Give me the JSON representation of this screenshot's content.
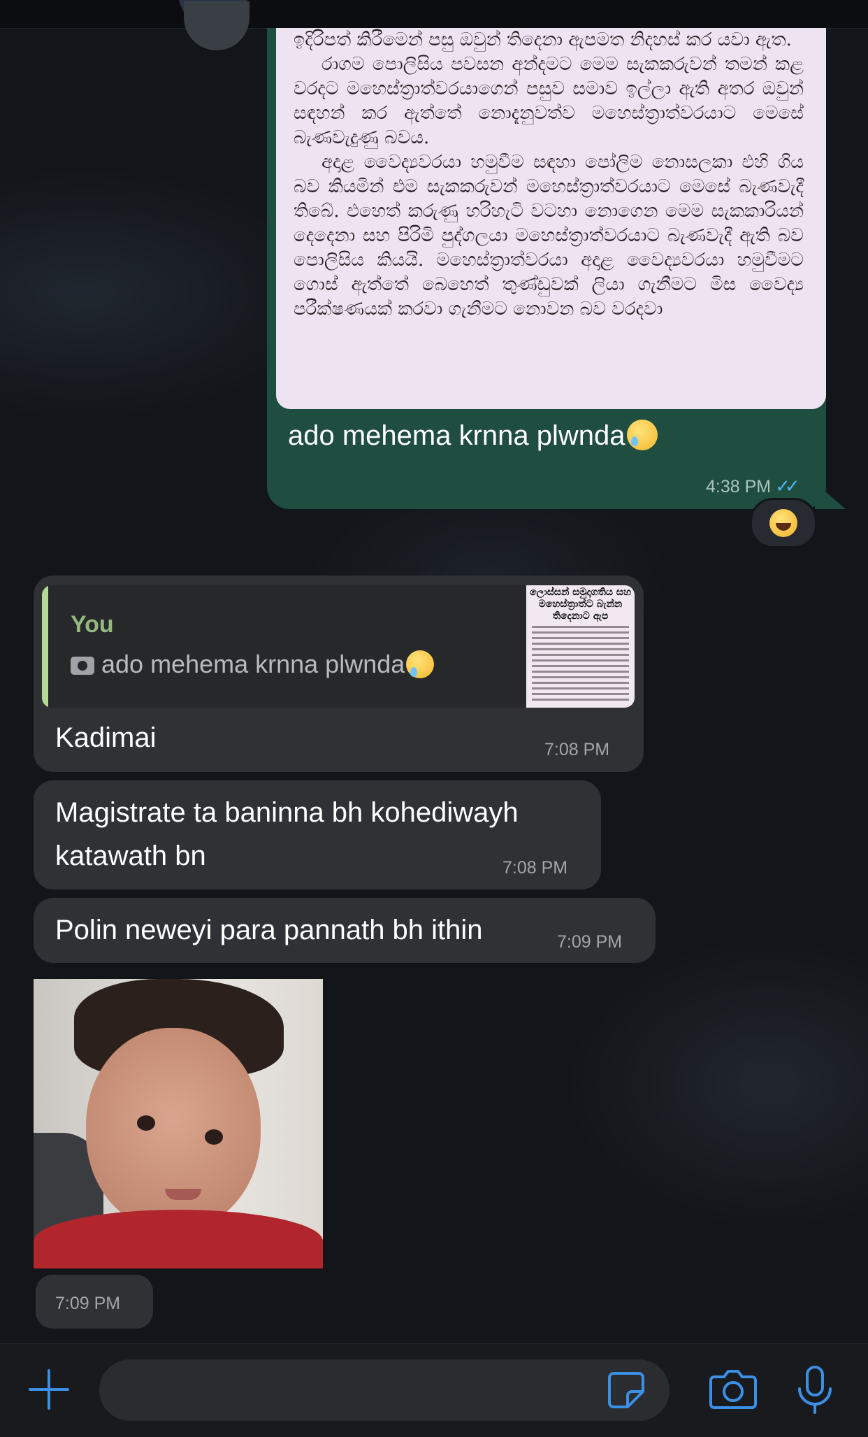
{
  "outgoing": {
    "document_paragraphs": [
      "ඉදිරිපත් කිරීමෙන් පසු ඔවුන් තිදෙනා ඇපමත නිදහස් කර යවා ඇත.",
      "රාගම පොලිසිය පවසන අන්දමට මෙම සැකකරුවන් තමන් කළ වරදට මහෙස්ත්‍රාත්වරයාගෙන් පසුව සමාව ඉල්ලා ඇති අතර ඔවුන් සඳහන් කර ඇත්තේ නොදැනුවත්ව මහෙස්ත්‍රාත්වරයාට මෙසේ බැණවැදුණු බවය.",
      "අදාළ වෛද්‍යවරයා හමුවීම සඳහා පෝලිම නොසලකා එහි ගිය බව කියමින් එම සැකකරුවන් මහෙස්ත්‍රාත්වරයාට මෙසේ බැණවැදී තිබේ. එහෙත් කරුණු හරිහැටි වටහා නොගෙන මෙම සැකකාරියන් දෙදෙනා සහ පිරිමි පුද්ගලයා මහෙස්ත්‍රාත්වරයාට බැණවැදී ඇති බව පොලිසිය කියයි. මහෙස්ත්‍රාත්වරයා අදාළ වෛද්‍යවරයා හමුවීමට ගොස් ඇත්තේ බෙහෙත් තුණ්ඩුවක් ලියා ගැනීමට මිස වෛද්‍ය පරීක්ෂණයක් කරවා ගැනීමට නොවන බව වරදවා"
    ],
    "caption": "ado mehema krnna plwnda",
    "time": "4:38 PM",
    "ticks": "✓✓",
    "reaction": "laughing-tears"
  },
  "incoming": [
    {
      "quote_author": "You",
      "quote_text": "ado mehema krnna plwnda",
      "quote_thumb_headline": "ලොස්සන් සමුදාගතිය සහ මහෙස්ත්‍රාත්ට බැන්න තිදෙනාට ඇප",
      "text": "Kadimai",
      "time": "7:08 PM"
    },
    {
      "text_line1": "Magistrate ta baninna bh kohediwayh",
      "text_line2": "katawath bn",
      "time": "7:08 PM"
    },
    {
      "text": "Polin neweyi para pannath bh ithin",
      "time": "7:09 PM"
    },
    {
      "photo": "baby-photo",
      "time": "7:09 PM"
    }
  ],
  "composer": {
    "value": "",
    "icons": [
      "plus-icon",
      "sticker-icon",
      "camera-icon",
      "microphone-icon"
    ],
    "accent": "#3b8fe5"
  }
}
